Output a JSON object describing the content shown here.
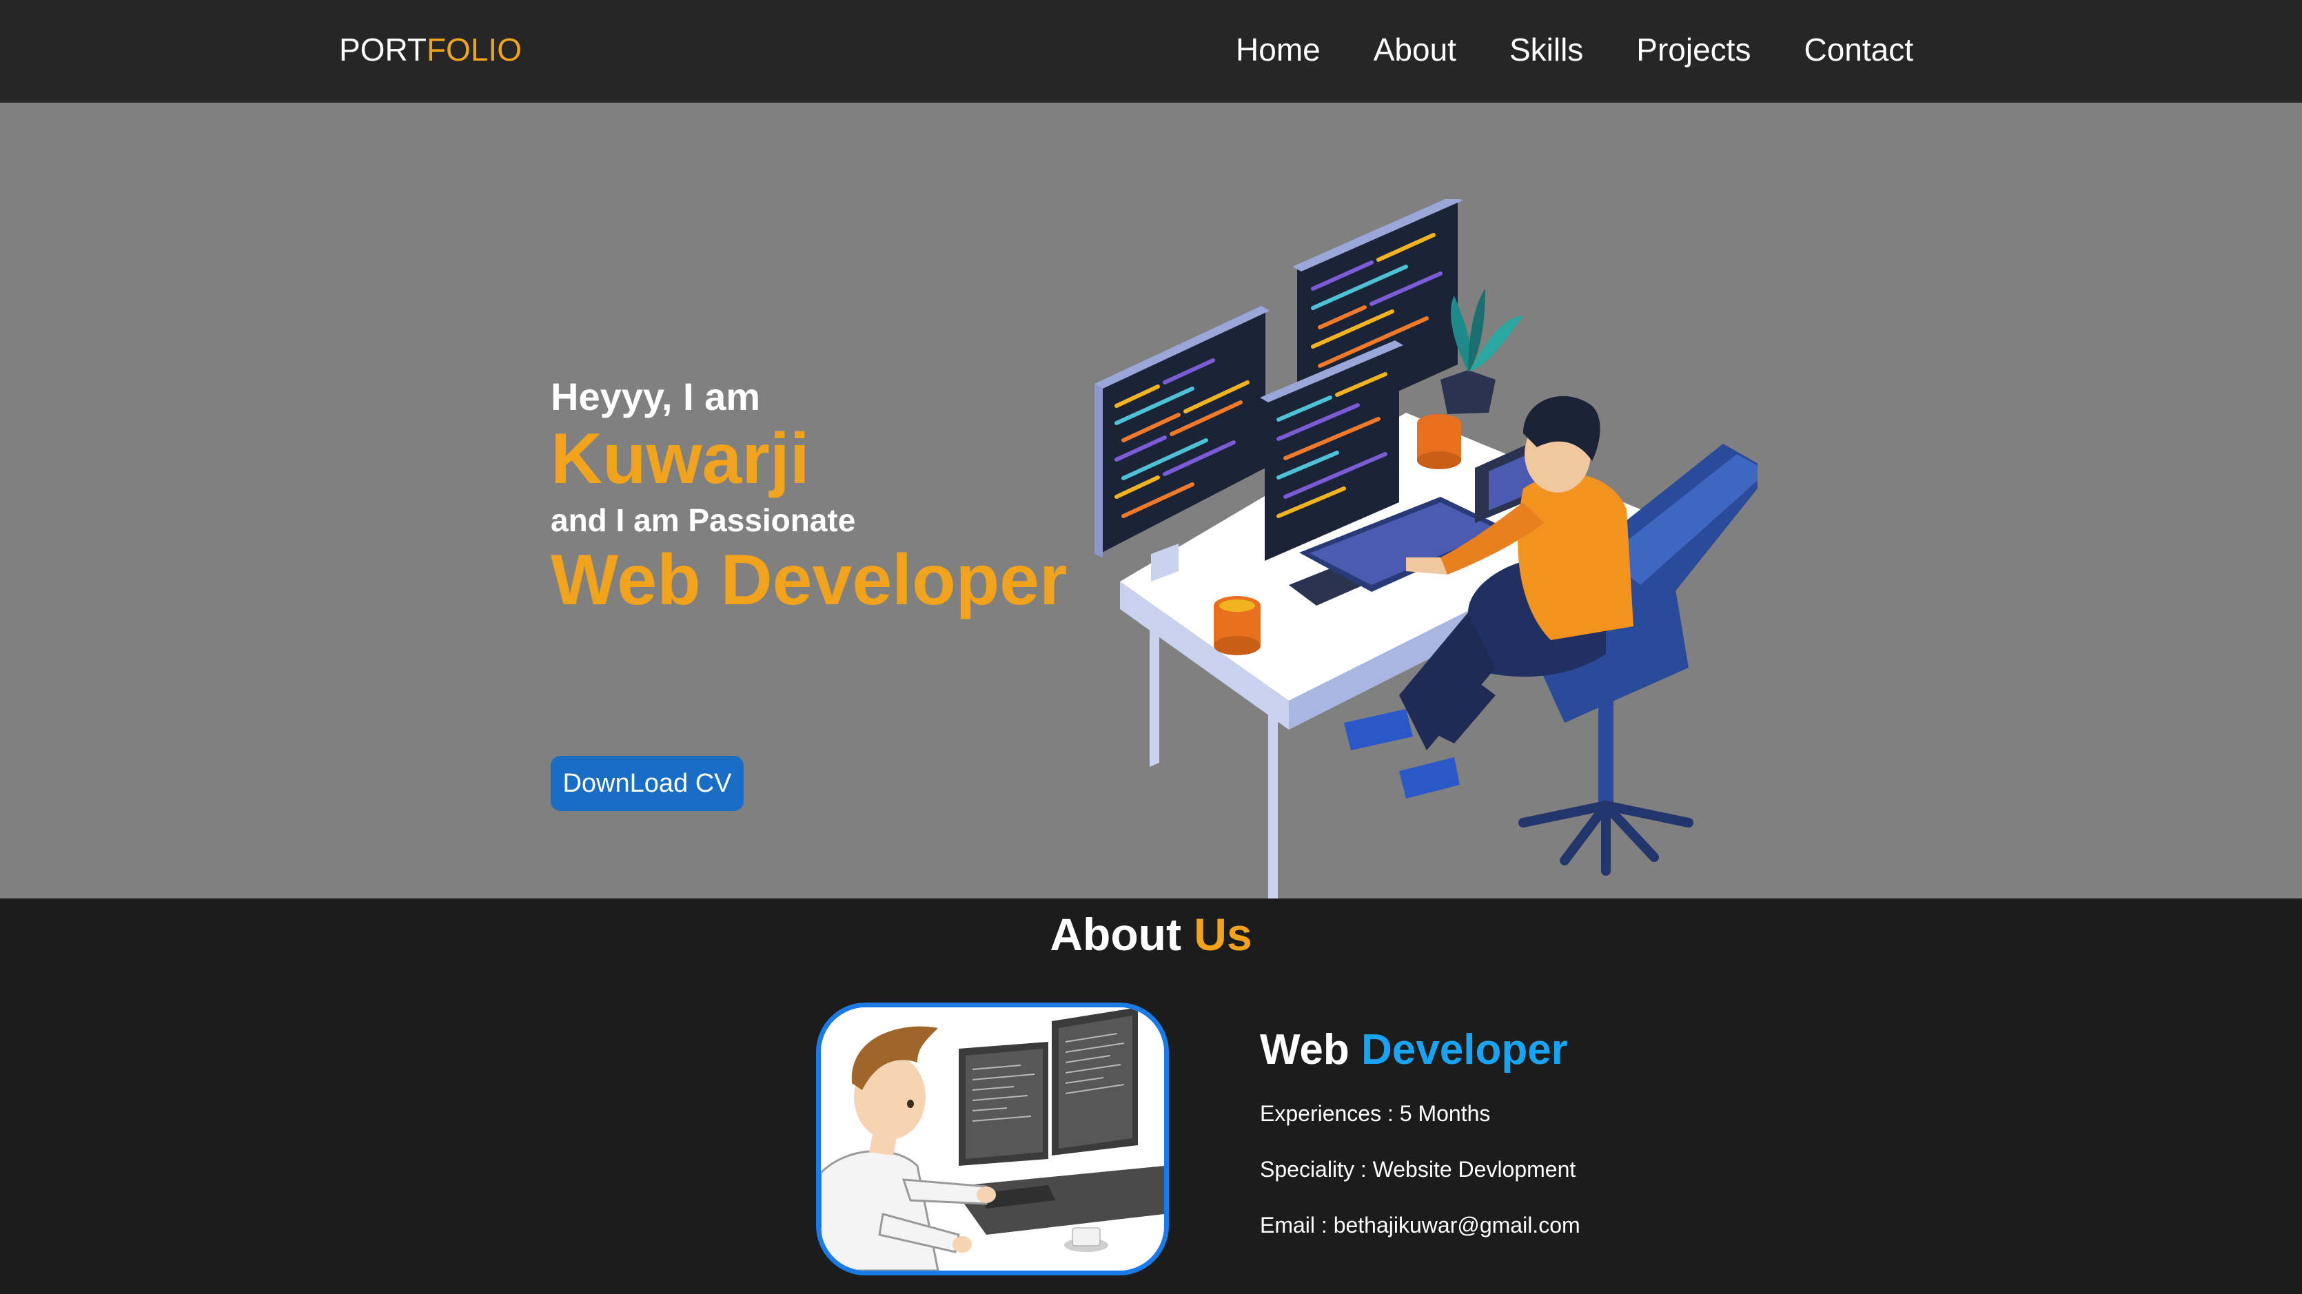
{
  "nav": {
    "logo_part1": "PORT",
    "logo_part2": "FOLIO",
    "links": [
      "Home",
      "About",
      "Skills",
      "Projects",
      "Contact"
    ]
  },
  "hero": {
    "greeting": "Heyyy, I am",
    "name": "Kuwarji",
    "passion": "and I am Passionate",
    "role": "Web Developer",
    "cv_button": "DownLoad CV",
    "illustration": "developer-at-desk-illustration"
  },
  "about": {
    "title_part1": "About",
    "title_part2": "Us",
    "photo": "developer-at-computer-cartoon",
    "info_title_part1": "Web",
    "info_title_part2": "Developer",
    "experience_label": "Experiences :",
    "experience_value": "5 Months",
    "speciality_label": "Speciality :",
    "speciality_value": "Website Devlopment",
    "email_label": "Email :",
    "email_value": "bethajikuwar@gmail.com"
  },
  "colors": {
    "nav_bg": "#262626",
    "hero_bg": "#808080",
    "about_bg": "#1c1c1c",
    "accent_orange": "#f1a31d",
    "accent_blue": "#1aa3f0",
    "button_blue": "#1a6dc5"
  }
}
